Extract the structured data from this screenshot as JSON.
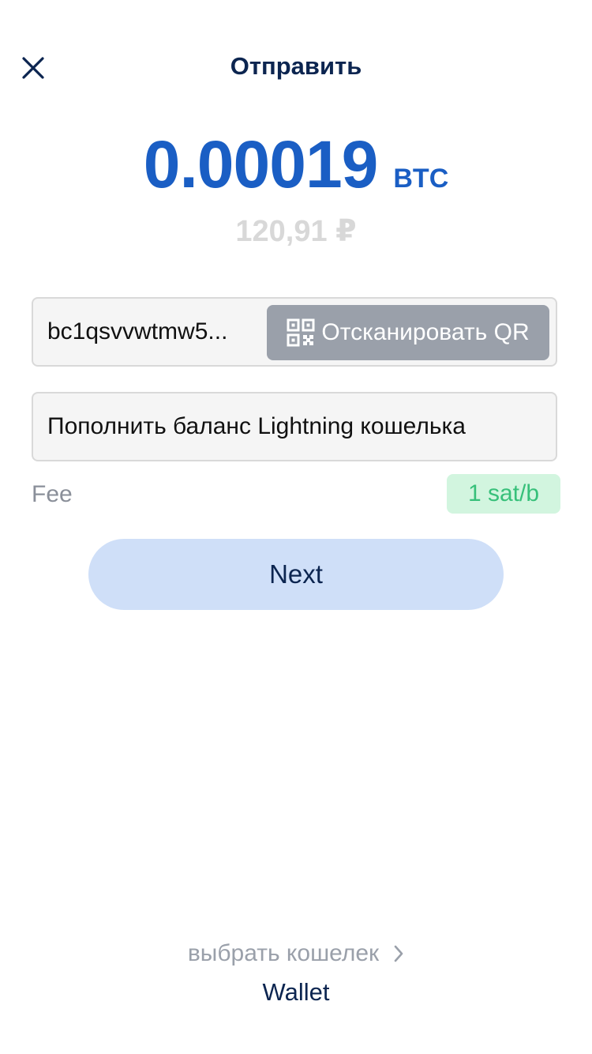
{
  "header": {
    "title": "Отправить",
    "close_icon": "close-icon"
  },
  "amount": {
    "value": "0.00019",
    "unit": "BTC",
    "fiat": "120,91 ₽"
  },
  "address": {
    "value": "bc1qsvvwtmw5...",
    "scan_label": "Отсканировать QR",
    "scan_icon": "qr-code-icon"
  },
  "memo": {
    "value": "Пополнить баланс Lightning кошелька"
  },
  "fee": {
    "label": "Fee",
    "value": "1 sat/b"
  },
  "next": {
    "label": "Next"
  },
  "wallet": {
    "choose_label": "выбрать кошелек",
    "chevron_icon": "chevron-right-icon",
    "name": "Wallet"
  },
  "colors": {
    "accent": "#1a5ec4",
    "title": "#0c2550",
    "fee_bg": "#d2f5df",
    "fee_text": "#37c07a",
    "next_bg": "#cfdff8",
    "scan_bg": "#9aa0aa"
  }
}
